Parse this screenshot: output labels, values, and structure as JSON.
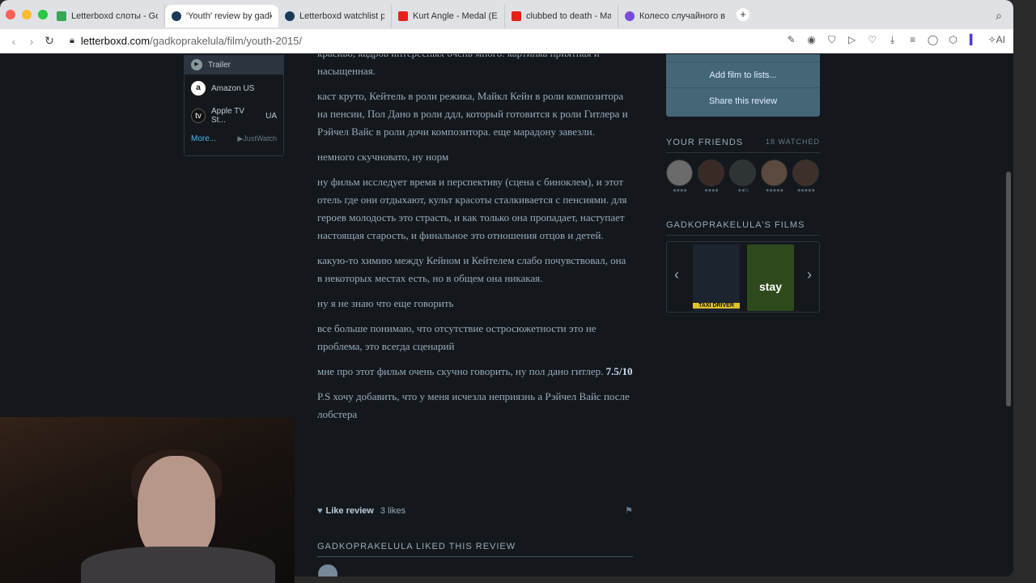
{
  "browser": {
    "tabs": [
      {
        "title": "Letterboxd слоты - Goo",
        "favicon_color": "#34a853",
        "active": false
      },
      {
        "title": "'Youth' review by gadkop",
        "favicon_color": "#1a3a5a",
        "active": true
      },
      {
        "title": "Letterboxd watchlist pic",
        "favicon_color": "#1a3a5a",
        "active": false
      },
      {
        "title": "Kurt Angle - Medal (Entr",
        "favicon_color": "#e62117",
        "active": false
      },
      {
        "title": "clubbed to death - Matri",
        "favicon_color": "#e62117",
        "active": false
      },
      {
        "title": "Колесо случайного вы",
        "favicon_color": "#7b4bd8",
        "active": false
      }
    ],
    "new_tab_glyph": "+",
    "url_host": "letterboxd.com",
    "url_path": "/gadkoprakelula/film/youth-2015/",
    "ai_label": "AI"
  },
  "providers": {
    "trailer": "Trailer",
    "amazon": "Amazon US",
    "apple": "Apple TV St...",
    "apple_region": "UA",
    "more": "More...",
    "justwatch": "JustWatch"
  },
  "review": {
    "paragraphs": [
      "красиво, кадров интересных очень много. картинка приятная и насыщенная.",
      "каст круто, Кейтель в роли режика, Майкл Кейн в роли композитора на пенсии, Пол Дано в роли ддл, который готовится к роли Гитлера и Рэйчел Вайс в роли дочи композитора. еще марадону завезли.",
      "немного скучновато, ну норм",
      "ну фильм исследует время и перспективу (сцена с биноклем), и этот отель где они отдыхают, культ красоты сталкивается с пенсиями. для героев молодость это страсть, и как только она пропадает, наступает настоящая старость, и финальное это отношения отцов и детей.",
      "какую-то химию между Кейном и Кейтелем слабо почувствовал, она в некоторых местах есть, но в общем она никакая.",
      "ну я не знаю что еще говорить",
      "все больше понимаю, что отсутствие остросюжетности это не проблема, это всегда сценарий"
    ],
    "rating_para_text": "мне про этот фильм очень скучно говорить, ну пол дано гитлер.",
    "rating": "7.5/10",
    "ps": "P.S хочу добавить, что у меня исчезла неприязнь а Рэйчел Вайс после лобстера",
    "like_label": "Like review",
    "likes_count": "3 likes",
    "liked_heading": "GADKOPRAKELULA LIKED THIS REVIEW"
  },
  "sidebar": {
    "add_to_lists": "Add film to lists...",
    "share": "Share this review",
    "friends_heading": "YOUR FRIENDS",
    "friends_watched": "18 WATCHED",
    "friends": [
      {
        "rating": "★★★★"
      },
      {
        "rating": "★★★★"
      },
      {
        "rating": "★★½"
      },
      {
        "rating": "★★★★★"
      },
      {
        "rating": "★★★★★"
      }
    ],
    "films_heading": "GADKOPRAKELULA'S FILMS",
    "posters": [
      {
        "title": "TAXI DRIVER",
        "bg": "#1c2430"
      },
      {
        "title": "stay",
        "bg": "#2e4a1c"
      }
    ]
  },
  "colors": {
    "page_bg": "#14181c",
    "accent_blue": "#40bcf4",
    "text_muted": "#9aabb8"
  }
}
